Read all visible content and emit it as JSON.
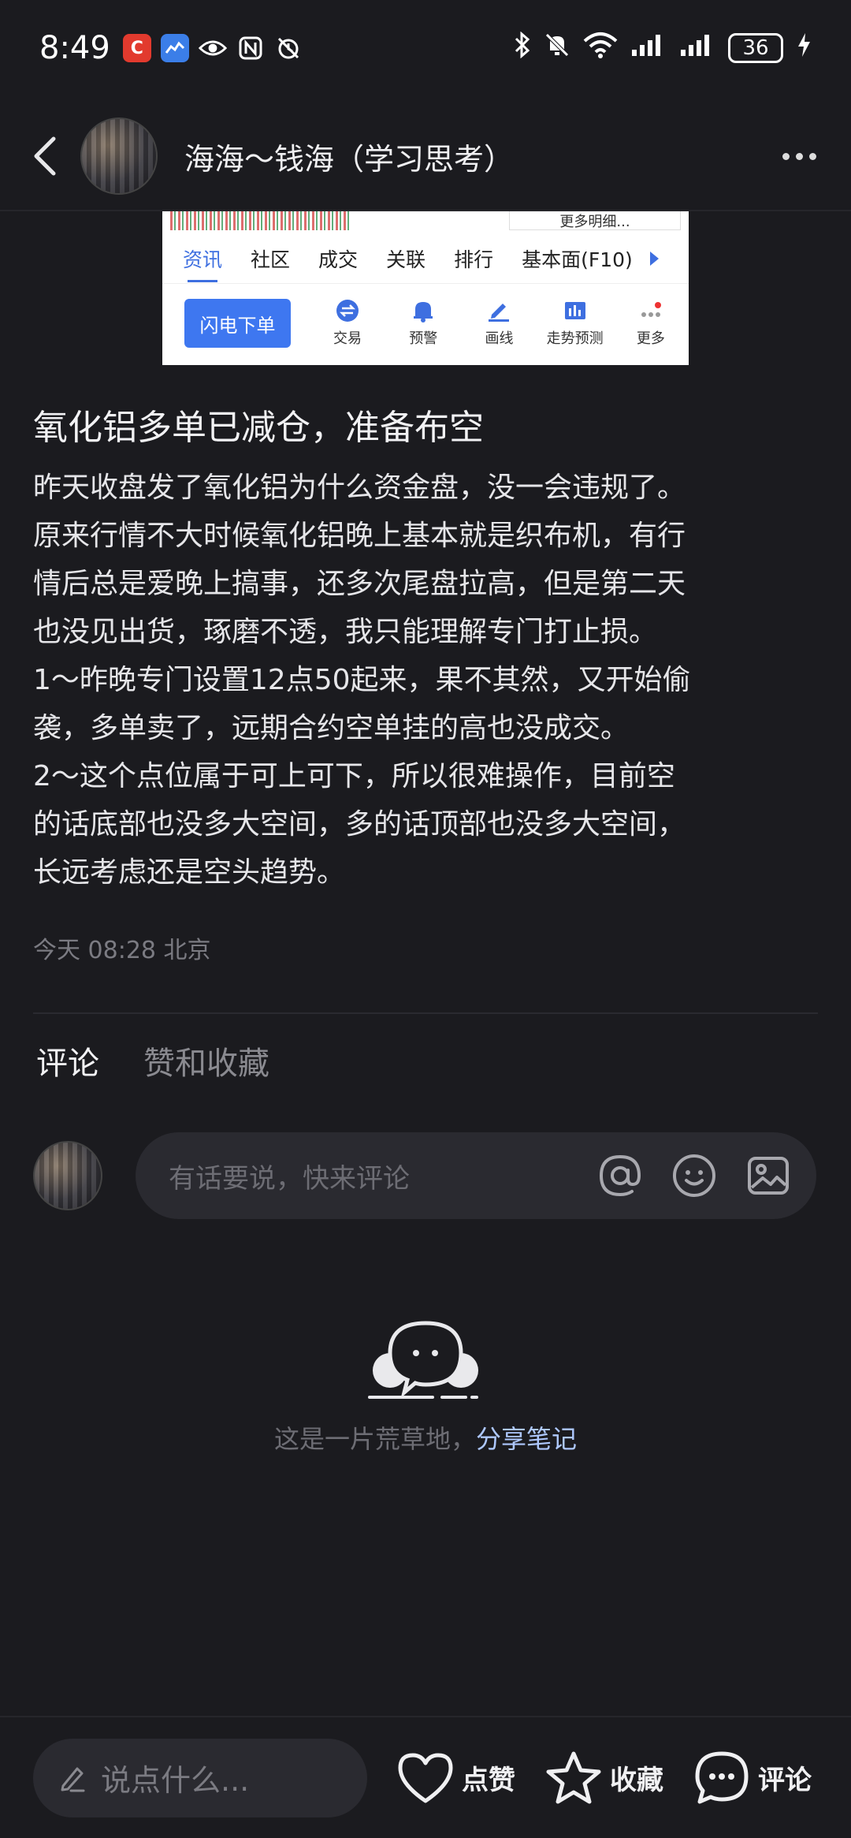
{
  "status_bar": {
    "time": "8:49",
    "battery": "36"
  },
  "header": {
    "title": "海海～钱海（学习思考）"
  },
  "embedded_image": {
    "top_right_label": "更多明细...",
    "tabs": [
      "资讯",
      "社区",
      "成交",
      "关联",
      "排行",
      "基本面(F10)"
    ],
    "active_tab": "资讯",
    "flash_button": "闪电下单",
    "actions": [
      "交易",
      "预警",
      "画线",
      "走势预测",
      "更多"
    ]
  },
  "post": {
    "title": "氧化铝多单已减仓，准备布空",
    "lines": [
      "昨天收盘发了氧化铝为什么资金盘，没一会违规了。",
      "原来行情不大时候氧化铝晚上基本就是织布机，有行",
      "情后总是爱晚上搞事，还多次尾盘拉高，但是第二天",
      "也没见出货，琢磨不透，我只能理解专门打止损。",
      "1～昨晚专门设置12点50起来，果不其然，又开始偷",
      "袭，多单卖了，远期合约空单挂的高也没成交。",
      "2～这个点位属于可上可下，所以很难操作，目前空",
      "的话底部也没多大空间，多的话顶部也没多大空间，",
      "长远考虑还是空头趋势。"
    ],
    "meta": "今天 08:28 北京"
  },
  "tabs": {
    "comments": "评论",
    "likes_collections": "赞和收藏"
  },
  "comment_box": {
    "placeholder": "有话要说，快来评论"
  },
  "empty_state": {
    "text": "这是一片荒草地，",
    "link": "分享笔记"
  },
  "bottom_bar": {
    "input_placeholder": "说点什么...",
    "like_label": "点赞",
    "collect_label": "收藏",
    "comment_label": "评论"
  }
}
